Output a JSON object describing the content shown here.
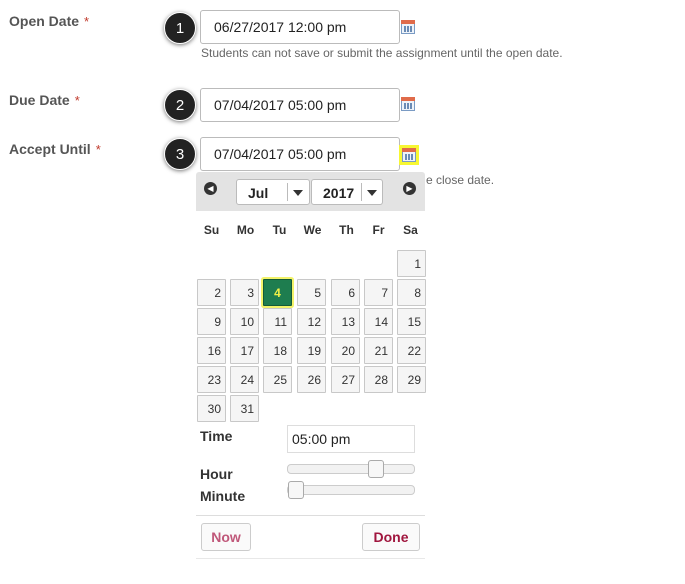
{
  "fields": {
    "open": {
      "label": "Open Date",
      "value": "06/27/2017 12:00 pm",
      "hint": "Students can not save or submit the assignment until the open date.",
      "step": "1"
    },
    "due": {
      "label": "Due Date",
      "value": "07/04/2017 05:00 pm",
      "step": "2"
    },
    "accept": {
      "label": "Accept Until",
      "value": "07/04/2017 05:00 pm",
      "hint_tail": "e close date.",
      "step": "3"
    },
    "required_mark": "*"
  },
  "datepicker": {
    "month": "Jul",
    "year": "2017",
    "weekdays": [
      "Su",
      "Mo",
      "Tu",
      "We",
      "Th",
      "Fr",
      "Sa"
    ],
    "first_weekday_index": 6,
    "days_in_month": 31,
    "selected_day": 4,
    "time_label": "Time",
    "time_value": "05:00 pm",
    "hour_label": "Hour",
    "minute_label": "Minute",
    "hour_fraction": 0.71,
    "minute_fraction": 0.0,
    "now_label": "Now",
    "done_label": "Done"
  },
  "colors": {
    "selected_day_bg": "#1e7d4f",
    "highlight": "#f7f732",
    "button_now": "#c0587a",
    "button_done": "#a0163e"
  }
}
